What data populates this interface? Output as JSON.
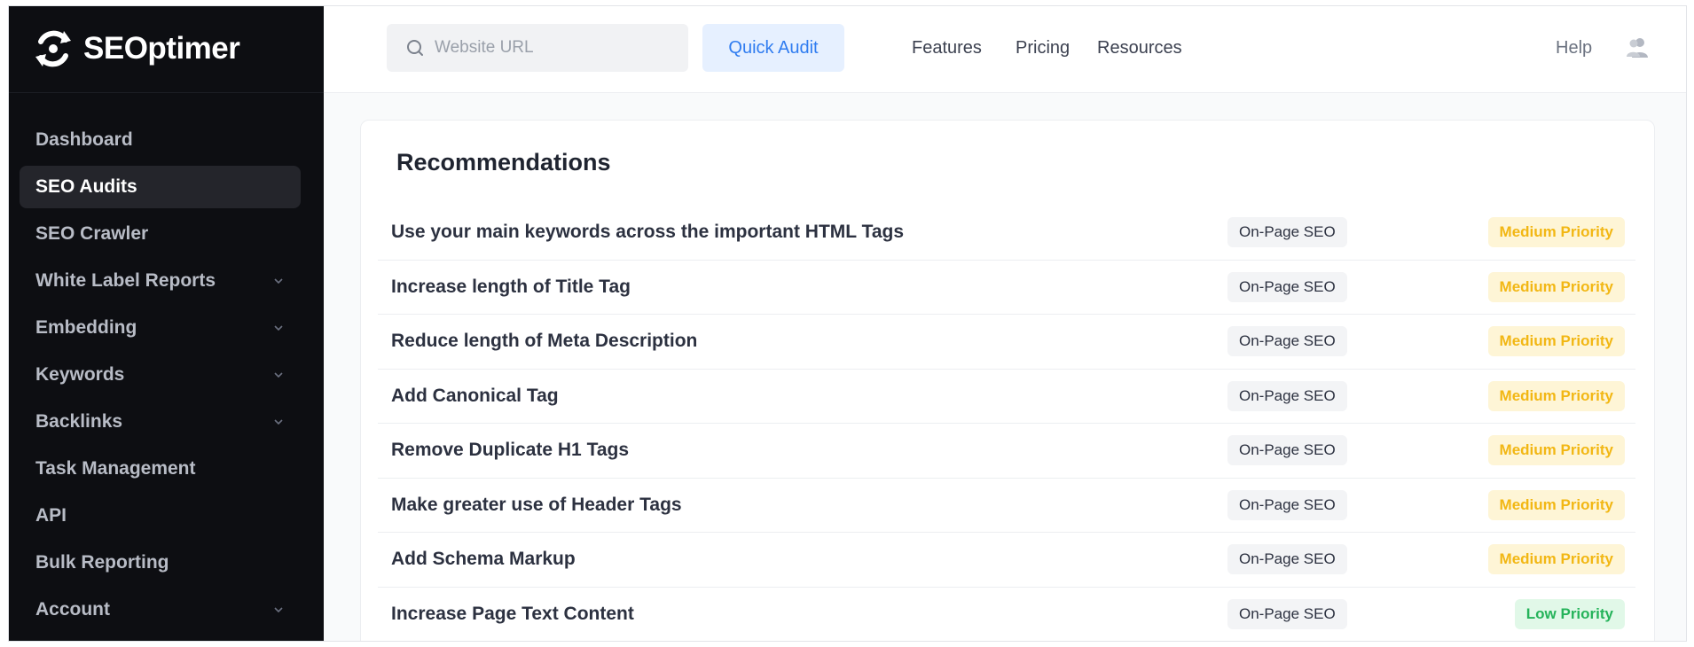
{
  "brand": {
    "name": "SEOptimer"
  },
  "sidebar": {
    "items": [
      {
        "label": "Dashboard",
        "icon": "",
        "active": false,
        "expandable": false
      },
      {
        "label": "SEO Audits",
        "active": true,
        "expandable": false
      },
      {
        "label": "SEO Crawler",
        "active": false,
        "expandable": false
      },
      {
        "label": "White Label Reports",
        "active": false,
        "expandable": true
      },
      {
        "label": "Embedding",
        "active": false,
        "expandable": true
      },
      {
        "label": "Keywords",
        "active": false,
        "expandable": true
      },
      {
        "label": "Backlinks",
        "active": false,
        "expandable": true
      },
      {
        "label": "Task Management",
        "active": false,
        "expandable": false
      },
      {
        "label": "API",
        "active": false,
        "expandable": false
      },
      {
        "label": "Bulk Reporting",
        "active": false,
        "expandable": false
      },
      {
        "label": "Account",
        "active": false,
        "expandable": true
      }
    ]
  },
  "topbar": {
    "search_placeholder": "Website URL",
    "search_value": "",
    "quick_audit_label": "Quick Audit",
    "links": [
      "Features",
      "Pricing",
      "Resources"
    ],
    "help_label": "Help"
  },
  "recommendations": {
    "title": "Recommendations",
    "rows": [
      {
        "text": "Use your main keywords across the important HTML Tags",
        "category": "On-Page SEO",
        "priority": "Medium Priority",
        "level": "medium"
      },
      {
        "text": "Increase length of Title Tag",
        "category": "On-Page SEO",
        "priority": "Medium Priority",
        "level": "medium"
      },
      {
        "text": "Reduce length of Meta Description",
        "category": "On-Page SEO",
        "priority": "Medium Priority",
        "level": "medium"
      },
      {
        "text": "Add Canonical Tag",
        "category": "On-Page SEO",
        "priority": "Medium Priority",
        "level": "medium"
      },
      {
        "text": "Remove Duplicate H1 Tags",
        "category": "On-Page SEO",
        "priority": "Medium Priority",
        "level": "medium"
      },
      {
        "text": "Make greater use of Header Tags",
        "category": "On-Page SEO",
        "priority": "Medium Priority",
        "level": "medium"
      },
      {
        "text": "Add Schema Markup",
        "category": "On-Page SEO",
        "priority": "Medium Priority",
        "level": "medium"
      },
      {
        "text": "Increase Page Text Content",
        "category": "On-Page SEO",
        "priority": "Low Priority",
        "level": "low"
      }
    ]
  },
  "colors": {
    "sidebar_bg": "#0d0e12",
    "accent": "#2f7cf0",
    "medium_priority": "#f2b714",
    "low_priority": "#25b35a"
  }
}
